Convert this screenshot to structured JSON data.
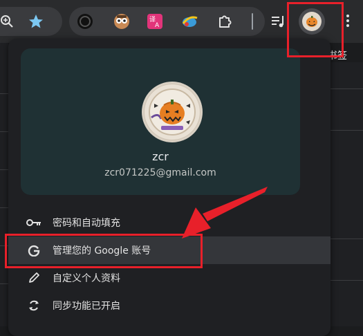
{
  "toolbar": {
    "icons": [
      "zoom-icon",
      "bookmark-star-icon",
      "extension-circle-icon",
      "extension-face-icon",
      "translate-icon",
      "ie-tab-icon",
      "extensions-puzzle-icon",
      "media-control-icon",
      "profile-avatar-icon",
      "more-menu-icon"
    ],
    "bookmark_hint": "书签"
  },
  "profile": {
    "name": "zcr",
    "email": "zcr071225@gmail.com"
  },
  "menu": {
    "items": [
      {
        "label": "密码和自动填充",
        "icon": "key-icon"
      },
      {
        "label": "管理您的 Google 账号",
        "icon": "google-g-icon"
      },
      {
        "label": "自定义个人资料",
        "icon": "pencil-icon"
      },
      {
        "label": "同步功能已开启",
        "icon": "sync-icon"
      }
    ]
  },
  "colors": {
    "accent_annotation": "#e8202a",
    "card_bg": "#1f3134",
    "popup_bg": "#1f2023"
  }
}
